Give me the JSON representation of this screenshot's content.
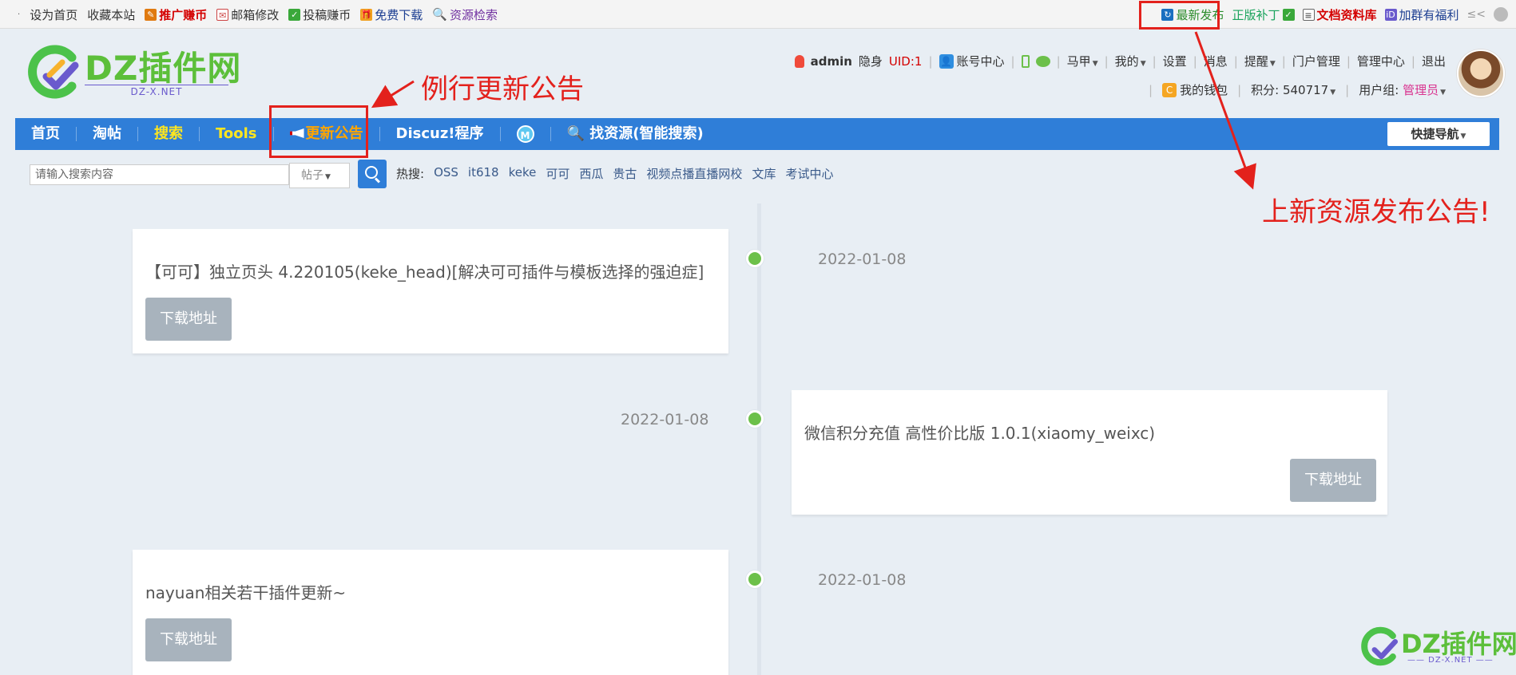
{
  "topbar": {
    "left": [
      {
        "label": "设为首页"
      },
      {
        "label": "收藏本站"
      },
      {
        "label": "推广赚币"
      },
      {
        "label": "邮箱修改"
      },
      {
        "label": "投稿赚币"
      },
      {
        "label": "免费下载"
      },
      {
        "label": "资源检索"
      }
    ],
    "right": [
      {
        "label": "最新发布"
      },
      {
        "label": "正版补丁"
      },
      {
        "label": "文档资料库"
      },
      {
        "label": "加群有福利"
      }
    ],
    "more": "≤<"
  },
  "logo": {
    "text": "DZ插件网",
    "sub": "DZ-X.NET"
  },
  "user": {
    "name": "admin",
    "stealth": "隐身",
    "uid": "UID:1",
    "account_center": "账号中心",
    "majia": "马甲",
    "mine": "我的",
    "settings": "设置",
    "messages": "消息",
    "remind": "提醒",
    "portal_manage": "门户管理",
    "admin_center": "管理中心",
    "logout": "退出",
    "wallet": "我的钱包",
    "points": "积分: 540717",
    "group_label": "用户组:",
    "group": "管理员"
  },
  "nav": {
    "items": [
      {
        "label": "首页"
      },
      {
        "label": "淘帖"
      },
      {
        "label": "搜索"
      },
      {
        "label": "Tools"
      },
      {
        "label": "更新公告"
      },
      {
        "label": "Discuz!程序"
      },
      {
        "label": "M"
      },
      {
        "label": "找资源(智能搜索)"
      }
    ],
    "quick": "快捷导航"
  },
  "search": {
    "placeholder": "请输入搜索内容",
    "type": "帖子",
    "hot_label": "热搜:",
    "hot": [
      "OSS",
      "it618",
      "keke",
      "可可",
      "西瓜",
      "贵古",
      "视频点播直播网校",
      "文库",
      "考试中心"
    ]
  },
  "timeline": [
    {
      "title": "【可可】独立页头 4.220105(keke_head)[解决可可插件与模板选择的强迫症]",
      "date": "2022-01-08",
      "button": "下载地址",
      "side": "left"
    },
    {
      "title": "微信积分充值 高性价比版 1.0.1(xiaomy_weixc)",
      "date": "2022-01-08",
      "button": "下载地址",
      "side": "right"
    },
    {
      "title": "nayuan相关若干插件更新~",
      "date": "2022-01-08",
      "button": "下载地址",
      "side": "left"
    }
  ],
  "annotations": {
    "routine": "例行更新公告",
    "new_resource": "上新资源发布公告!"
  },
  "watermark": {
    "text": "DZ插件网",
    "sub": "—— DZ-X.NET ——"
  },
  "colors": {
    "nav": "#2f7ed8",
    "accent_green": "#6cc04a",
    "annotation_red": "#e3211c"
  }
}
